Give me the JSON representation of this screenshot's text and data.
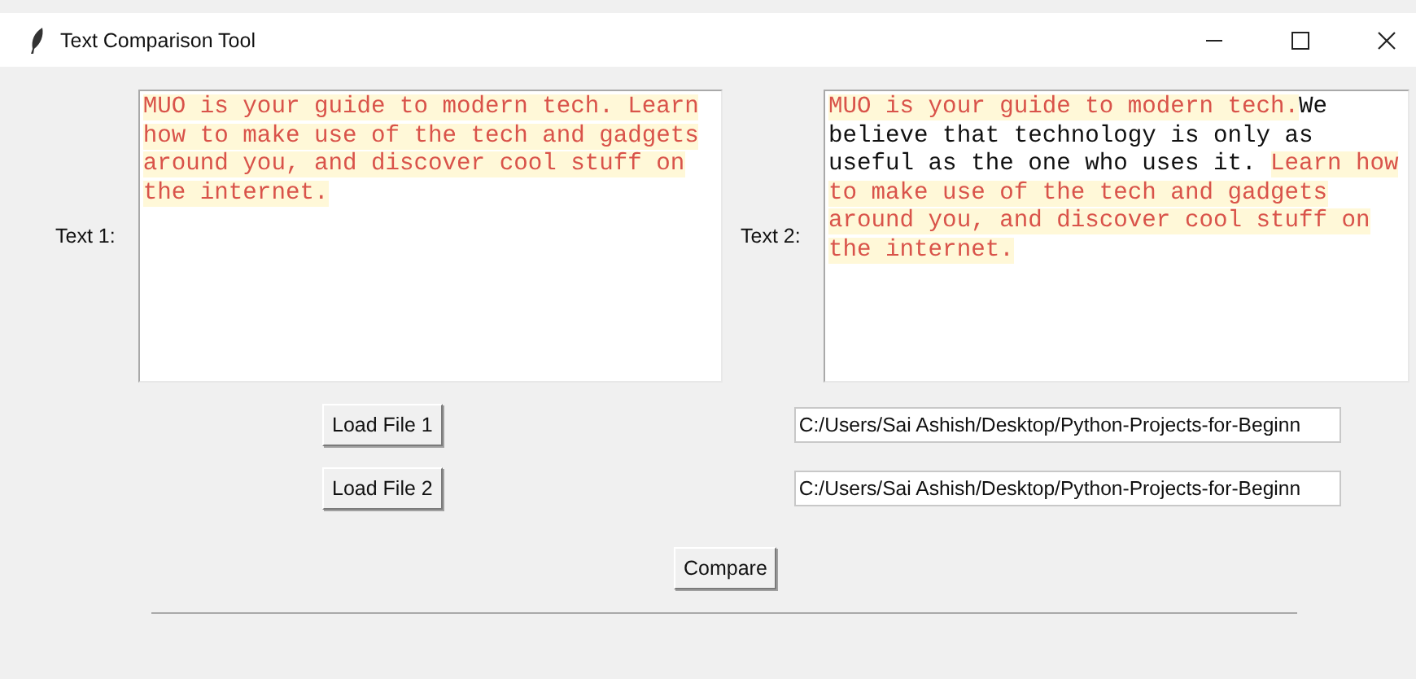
{
  "window": {
    "title": "Text Comparison Tool"
  },
  "texts": [
    {
      "label": "Text 1:",
      "lines": [
        [
          {
            "text": "MUO is your guide to modern tech. Learn",
            "diff": true
          }
        ],
        [
          {
            "text": "how to make use of the tech and gadgets",
            "diff": true
          }
        ],
        [
          {
            "text": "around you, and discover cool stuff on",
            "diff": true
          }
        ],
        [
          {
            "text": "the internet.",
            "diff": true
          }
        ]
      ]
    },
    {
      "label": "Text 2:",
      "lines": [
        [
          {
            "text": "MUO is your guide to modern tech.",
            "diff": true
          },
          {
            "text": "We",
            "diff": false
          }
        ],
        [
          {
            "text": "believe that technology is only as",
            "diff": false
          }
        ],
        [
          {
            "text": "useful as the one who uses it. ",
            "diff": false
          },
          {
            "text": "Learn how",
            "diff": true
          }
        ],
        [
          {
            "text": "to make use of the tech and gadgets",
            "diff": true
          }
        ],
        [
          {
            "text": "around you, and discover cool stuff on",
            "diff": true
          }
        ],
        [
          {
            "text": "the internet.",
            "diff": true
          }
        ]
      ]
    }
  ],
  "files": [
    {
      "button": "Load File 1",
      "path": "C:/Users/Sai Ashish/Desktop/Python-Projects-for-Beginn"
    },
    {
      "button": "Load File 2",
      "path": "C:/Users/Sai Ashish/Desktop/Python-Projects-for-Beginn"
    }
  ],
  "compare_button": "Compare"
}
